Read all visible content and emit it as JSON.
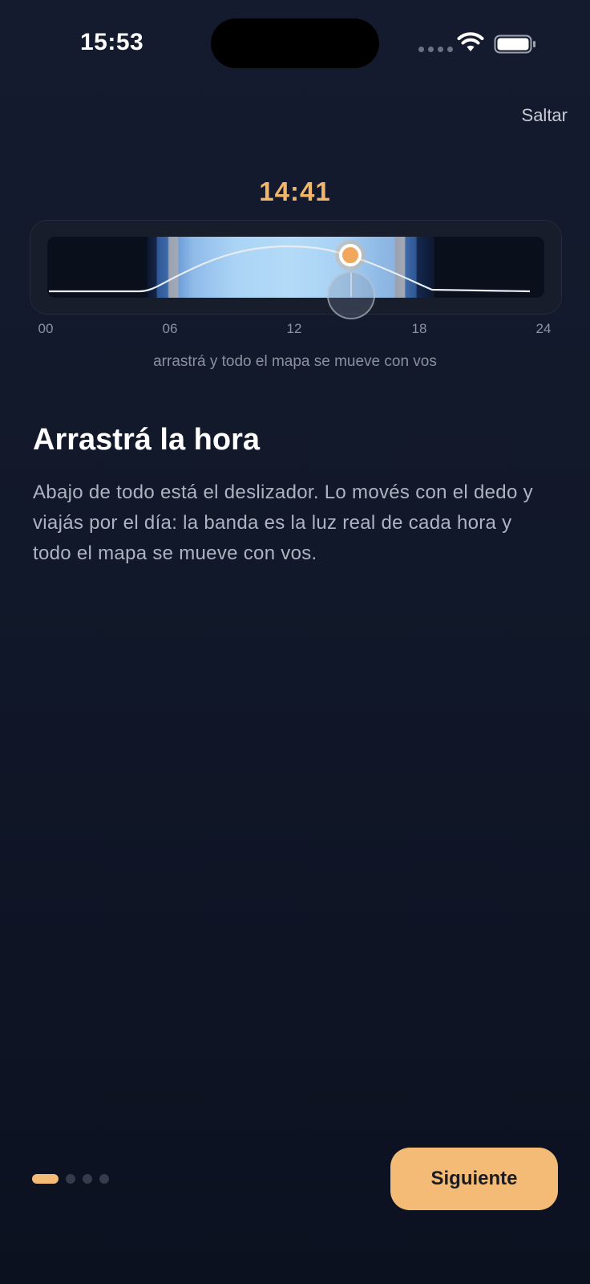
{
  "status_bar": {
    "time": "15:53",
    "wifi_icon": "wifi-icon",
    "battery_icon": "battery-icon",
    "signal_icon": "cellular-signal-dots"
  },
  "header": {
    "skip_label": "Saltar"
  },
  "time_slider": {
    "current_time": "14:41",
    "hour_labels": [
      "00",
      "06",
      "12",
      "18",
      "24"
    ],
    "hint": "arrastrá y todo el mapa se mueve con vos",
    "position_fraction": 0.612,
    "colors": {
      "accent": "#f1b56b",
      "sun_marker": "#f2a85c"
    }
  },
  "content": {
    "title": "Arrastrá la hora",
    "body": "Abajo de todo está el deslizador. Lo movés con el dedo y viajás por el día: la banda es la luz real de cada hora y todo el mapa se mueve con vos."
  },
  "footer": {
    "page_count": 4,
    "current_page": 1,
    "next_label": "Siguiente",
    "button_color": "#f3bb76"
  }
}
